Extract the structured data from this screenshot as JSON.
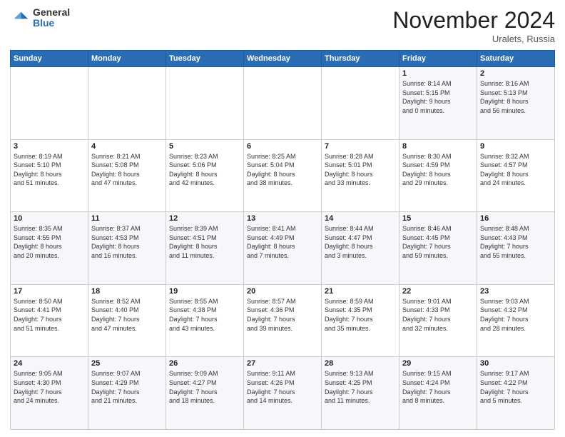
{
  "logo": {
    "general": "General",
    "blue": "Blue"
  },
  "header": {
    "month": "November 2024",
    "location": "Uralets, Russia"
  },
  "weekdays": [
    "Sunday",
    "Monday",
    "Tuesday",
    "Wednesday",
    "Thursday",
    "Friday",
    "Saturday"
  ],
  "weeks": [
    [
      {
        "day": "",
        "info": ""
      },
      {
        "day": "",
        "info": ""
      },
      {
        "day": "",
        "info": ""
      },
      {
        "day": "",
        "info": ""
      },
      {
        "day": "",
        "info": ""
      },
      {
        "day": "1",
        "info": "Sunrise: 8:14 AM\nSunset: 5:15 PM\nDaylight: 9 hours\nand 0 minutes."
      },
      {
        "day": "2",
        "info": "Sunrise: 8:16 AM\nSunset: 5:13 PM\nDaylight: 8 hours\nand 56 minutes."
      }
    ],
    [
      {
        "day": "3",
        "info": "Sunrise: 8:19 AM\nSunset: 5:10 PM\nDaylight: 8 hours\nand 51 minutes."
      },
      {
        "day": "4",
        "info": "Sunrise: 8:21 AM\nSunset: 5:08 PM\nDaylight: 8 hours\nand 47 minutes."
      },
      {
        "day": "5",
        "info": "Sunrise: 8:23 AM\nSunset: 5:06 PM\nDaylight: 8 hours\nand 42 minutes."
      },
      {
        "day": "6",
        "info": "Sunrise: 8:25 AM\nSunset: 5:04 PM\nDaylight: 8 hours\nand 38 minutes."
      },
      {
        "day": "7",
        "info": "Sunrise: 8:28 AM\nSunset: 5:01 PM\nDaylight: 8 hours\nand 33 minutes."
      },
      {
        "day": "8",
        "info": "Sunrise: 8:30 AM\nSunset: 4:59 PM\nDaylight: 8 hours\nand 29 minutes."
      },
      {
        "day": "9",
        "info": "Sunrise: 8:32 AM\nSunset: 4:57 PM\nDaylight: 8 hours\nand 24 minutes."
      }
    ],
    [
      {
        "day": "10",
        "info": "Sunrise: 8:35 AM\nSunset: 4:55 PM\nDaylight: 8 hours\nand 20 minutes."
      },
      {
        "day": "11",
        "info": "Sunrise: 8:37 AM\nSunset: 4:53 PM\nDaylight: 8 hours\nand 16 minutes."
      },
      {
        "day": "12",
        "info": "Sunrise: 8:39 AM\nSunset: 4:51 PM\nDaylight: 8 hours\nand 11 minutes."
      },
      {
        "day": "13",
        "info": "Sunrise: 8:41 AM\nSunset: 4:49 PM\nDaylight: 8 hours\nand 7 minutes."
      },
      {
        "day": "14",
        "info": "Sunrise: 8:44 AM\nSunset: 4:47 PM\nDaylight: 8 hours\nand 3 minutes."
      },
      {
        "day": "15",
        "info": "Sunrise: 8:46 AM\nSunset: 4:45 PM\nDaylight: 7 hours\nand 59 minutes."
      },
      {
        "day": "16",
        "info": "Sunrise: 8:48 AM\nSunset: 4:43 PM\nDaylight: 7 hours\nand 55 minutes."
      }
    ],
    [
      {
        "day": "17",
        "info": "Sunrise: 8:50 AM\nSunset: 4:41 PM\nDaylight: 7 hours\nand 51 minutes."
      },
      {
        "day": "18",
        "info": "Sunrise: 8:52 AM\nSunset: 4:40 PM\nDaylight: 7 hours\nand 47 minutes."
      },
      {
        "day": "19",
        "info": "Sunrise: 8:55 AM\nSunset: 4:38 PM\nDaylight: 7 hours\nand 43 minutes."
      },
      {
        "day": "20",
        "info": "Sunrise: 8:57 AM\nSunset: 4:36 PM\nDaylight: 7 hours\nand 39 minutes."
      },
      {
        "day": "21",
        "info": "Sunrise: 8:59 AM\nSunset: 4:35 PM\nDaylight: 7 hours\nand 35 minutes."
      },
      {
        "day": "22",
        "info": "Sunrise: 9:01 AM\nSunset: 4:33 PM\nDaylight: 7 hours\nand 32 minutes."
      },
      {
        "day": "23",
        "info": "Sunrise: 9:03 AM\nSunset: 4:32 PM\nDaylight: 7 hours\nand 28 minutes."
      }
    ],
    [
      {
        "day": "24",
        "info": "Sunrise: 9:05 AM\nSunset: 4:30 PM\nDaylight: 7 hours\nand 24 minutes."
      },
      {
        "day": "25",
        "info": "Sunrise: 9:07 AM\nSunset: 4:29 PM\nDaylight: 7 hours\nand 21 minutes."
      },
      {
        "day": "26",
        "info": "Sunrise: 9:09 AM\nSunset: 4:27 PM\nDaylight: 7 hours\nand 18 minutes."
      },
      {
        "day": "27",
        "info": "Sunrise: 9:11 AM\nSunset: 4:26 PM\nDaylight: 7 hours\nand 14 minutes."
      },
      {
        "day": "28",
        "info": "Sunrise: 9:13 AM\nSunset: 4:25 PM\nDaylight: 7 hours\nand 11 minutes."
      },
      {
        "day": "29",
        "info": "Sunrise: 9:15 AM\nSunset: 4:24 PM\nDaylight: 7 hours\nand 8 minutes."
      },
      {
        "day": "30",
        "info": "Sunrise: 9:17 AM\nSunset: 4:22 PM\nDaylight: 7 hours\nand 5 minutes."
      }
    ]
  ]
}
